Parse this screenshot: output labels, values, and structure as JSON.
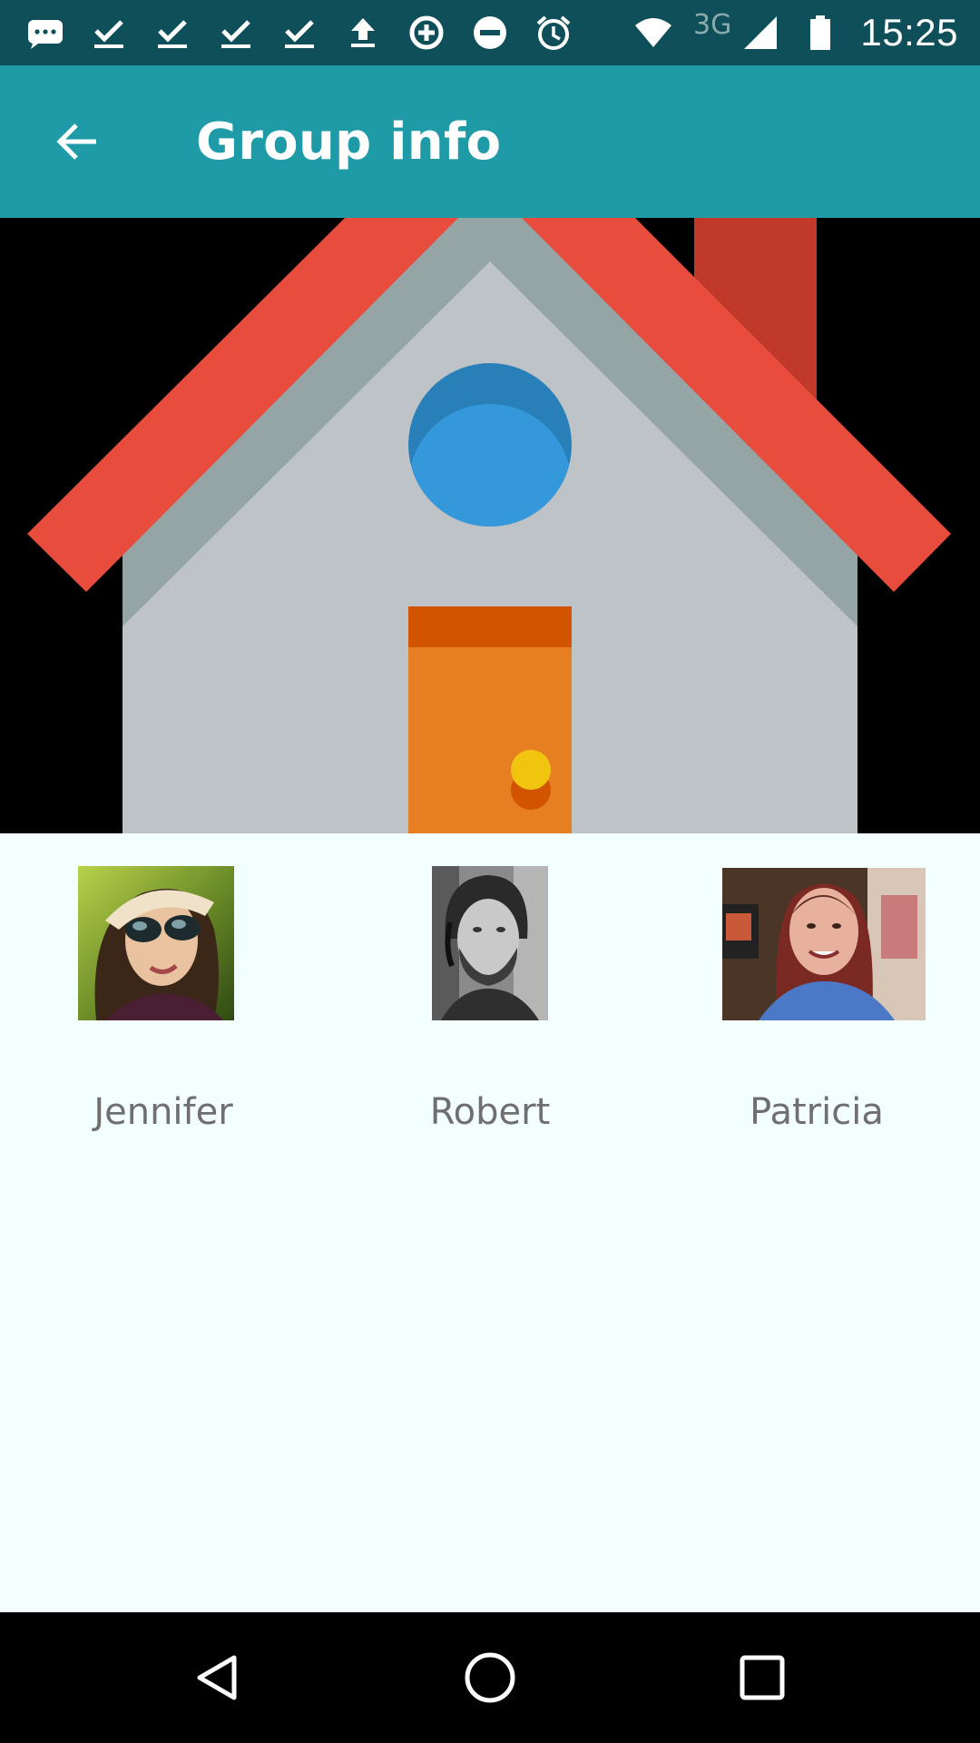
{
  "status_bar": {
    "left_icons": [
      "chat-bubble-icon",
      "download-done-icon",
      "download-done-icon",
      "download-done-icon",
      "download-done-icon",
      "upload-icon",
      "data-saver-icon",
      "do-not-disturb-icon",
      "alarm-icon"
    ],
    "network_label": "3G",
    "time": "15:25"
  },
  "app_bar": {
    "back_icon": "arrow-back-icon",
    "title": "Group info"
  },
  "hero": {
    "description_icon": "house-icon",
    "colors": {
      "background": "#000000",
      "roof": "#e74c3c",
      "chimney": "#c0392b",
      "wall": "#bdc3c7",
      "wall_shadow": "#95a5a6",
      "window": "#3498db",
      "window_top": "#2980b9",
      "door": "#e67e22",
      "door_top": "#d35400",
      "knob": "#f1c40f"
    }
  },
  "members": [
    {
      "name": "Jennifer"
    },
    {
      "name": "Robert"
    },
    {
      "name": "Patricia"
    }
  ],
  "nav_bar": {
    "buttons": [
      "back-triangle-icon",
      "home-circle-icon",
      "recents-square-icon"
    ]
  },
  "colors": {
    "status_bar": "#0e4f5a",
    "app_bar": "#1f9ba8",
    "content_bg": "#f3fffe",
    "name_text": "#6f6f6f"
  }
}
